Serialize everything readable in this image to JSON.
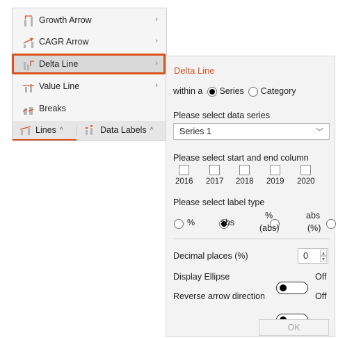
{
  "menu": {
    "items": [
      {
        "label": "Growth Arrow",
        "icon": "growth-arrow-icon",
        "has_submenu": true
      },
      {
        "label": "CAGR Arrow",
        "icon": "cagr-arrow-icon",
        "has_submenu": true
      },
      {
        "label": "Delta Line",
        "icon": "delta-line-icon",
        "has_submenu": true,
        "selected": true
      },
      {
        "label": "Value Line",
        "icon": "value-line-icon",
        "has_submenu": true
      },
      {
        "label": "Breaks",
        "icon": "breaks-icon",
        "has_submenu": false
      }
    ],
    "chevron": "›"
  },
  "tabs": {
    "lines": {
      "label": "Lines",
      "caret": "^",
      "icon": "lines-icon"
    },
    "data_labels": {
      "label": "Data Labels",
      "caret": "^",
      "icon": "data-labels-icon"
    }
  },
  "panel": {
    "title": "Delta Line",
    "within_label": "within a",
    "within_options": [
      {
        "label": "Series",
        "selected": true
      },
      {
        "label": "Category",
        "selected": false
      }
    ],
    "series_prompt": "Please select data series",
    "series_value": "Series 1",
    "column_prompt": "Please select start and end column",
    "years": [
      "2016",
      "2017",
      "2018",
      "2019",
      "2020"
    ],
    "label_type_prompt": "Please select label type",
    "label_types": [
      {
        "label": "%",
        "selected": false
      },
      {
        "label": "abs",
        "selected": true
      },
      {
        "label_top": "%",
        "label_bottom": "(abs)",
        "selected": false
      },
      {
        "label_top": "abs",
        "label_bottom": "(%)",
        "selected": false
      }
    ],
    "decimal_label": "Decimal places (%)",
    "decimal_value": "0",
    "ellipse_label": "Display Ellipse",
    "ellipse_state": "Off",
    "reverse_label": "Reverse arrow direction",
    "reverse_state": "Off",
    "ok_label": "OK"
  },
  "colors": {
    "accent": "#d9531e",
    "menu_bg": "#f5f5f5",
    "panel_bg": "#f3f3f3"
  }
}
